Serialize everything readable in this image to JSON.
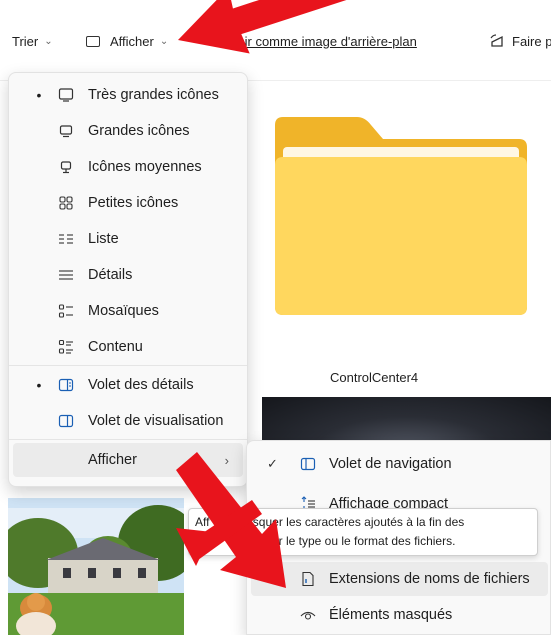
{
  "toolbar": {
    "sort_label": "Trier",
    "view_label": "Afficher",
    "wallpaper_label": "oisir comme image d'arrière-plan",
    "rotate_label": "Faire p"
  },
  "menu": {
    "items": [
      {
        "label": "Très grandes icônes",
        "selected": true,
        "icon": "monitor-large-icon"
      },
      {
        "label": "Grandes icônes",
        "selected": false,
        "icon": "monitor-icon"
      },
      {
        "label": "Icônes moyennes",
        "selected": false,
        "icon": "monitor-medium-icon"
      },
      {
        "label": "Petites icônes",
        "selected": false,
        "icon": "small-grid-icon"
      },
      {
        "label": "Liste",
        "selected": false,
        "icon": "list-icon"
      },
      {
        "label": "Détails",
        "selected": false,
        "icon": "details-icon"
      },
      {
        "label": "Mosaïques",
        "selected": false,
        "icon": "tiles-icon"
      },
      {
        "label": "Contenu",
        "selected": false,
        "icon": "content-icon"
      },
      {
        "label": "Volet des détails",
        "selected": true,
        "icon": "details-pane-icon"
      },
      {
        "label": "Volet de visualisation",
        "selected": false,
        "icon": "preview-pane-icon"
      },
      {
        "label": "Afficher",
        "selected": false,
        "icon": ""
      }
    ]
  },
  "submenu": {
    "items": [
      {
        "label": "Volet de navigation",
        "checked": true,
        "icon": "navigation-pane-icon"
      },
      {
        "label": "Affichage compact",
        "checked": false,
        "icon": "compact-view-icon"
      },
      {
        "label": "Extensions de noms de fichiers",
        "checked": false,
        "icon": "file-extension-icon"
      },
      {
        "label": "Éléments masqués",
        "checked": false,
        "icon": "eye-icon"
      }
    ]
  },
  "tooltip": {
    "line1": "Aff     u masquer les caractères ajoutés à la fin des",
    "line2": "          d'identifier le type ou le format des fichiers."
  },
  "files": {
    "controlcenter_label": "ControlCenter4"
  },
  "colors": {
    "arrow": "#e8141c",
    "folder_back": "#f0b429",
    "folder_front": "#ffd75e"
  }
}
